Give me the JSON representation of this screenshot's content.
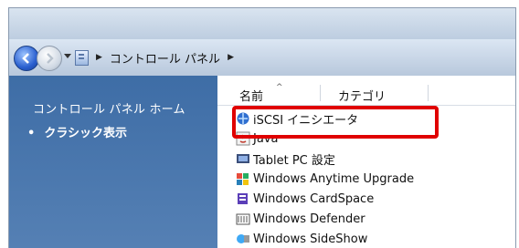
{
  "address": {
    "breadcrumb_label": "コントロール パネル"
  },
  "sidebar": {
    "home_label": "コントロール パネル ホーム",
    "classic_label": "クラシック表示",
    "bullet": "•"
  },
  "list": {
    "columns": {
      "name": "名前",
      "category": "カテゴリ"
    },
    "items": [
      {
        "label": "iSCSI イニシエータ"
      },
      {
        "label": "Java"
      },
      {
        "label": "Tablet PC 設定"
      },
      {
        "label": "Windows Anytime Upgrade"
      },
      {
        "label": "Windows CardSpace"
      },
      {
        "label": "Windows Defender"
      },
      {
        "label": "Windows SideShow"
      }
    ]
  },
  "colors": {
    "sidebar": "#3e6da6",
    "highlight": "#e00000"
  }
}
